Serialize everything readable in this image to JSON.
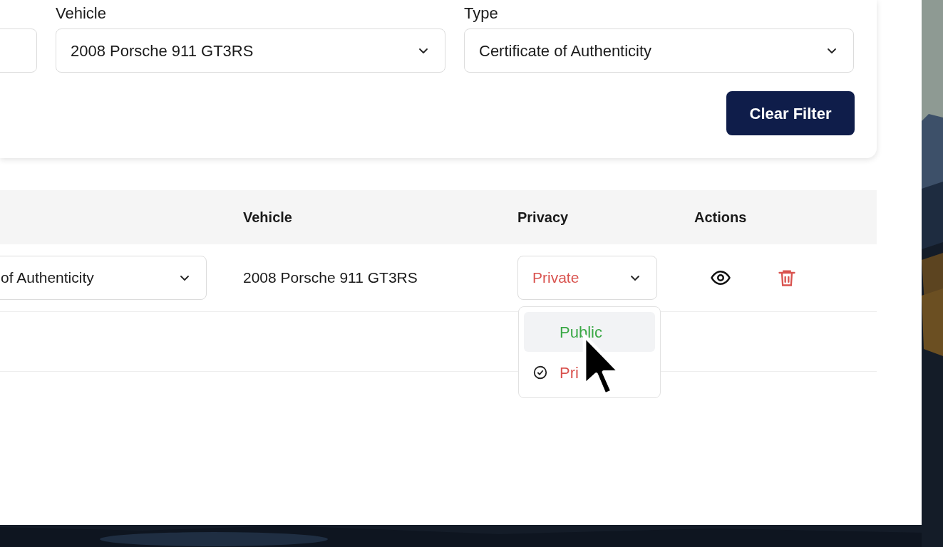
{
  "filters": [
    {
      "label": "Vehicle",
      "value": "2008 Porsche 911 GT3RS"
    },
    {
      "label": "Type",
      "value": "Certificate of Authenticity"
    }
  ],
  "clear_button": "Clear Filter",
  "table": {
    "columns": [
      "Vehicle",
      "Privacy",
      "Actions"
    ],
    "rows": [
      {
        "type": "of Authenticity",
        "vehicle": "2008 Porsche 911 GT3RS",
        "privacy": {
          "value": "Private",
          "color": "#d9534f",
          "expanded": true,
          "options": [
            {
              "label": "Public",
              "color": "#3aa845",
              "selected": false,
              "highlighted": true
            },
            {
              "label": "Pri",
              "color": "#d9534f",
              "selected": true,
              "highlighted": false
            }
          ]
        }
      }
    ]
  }
}
